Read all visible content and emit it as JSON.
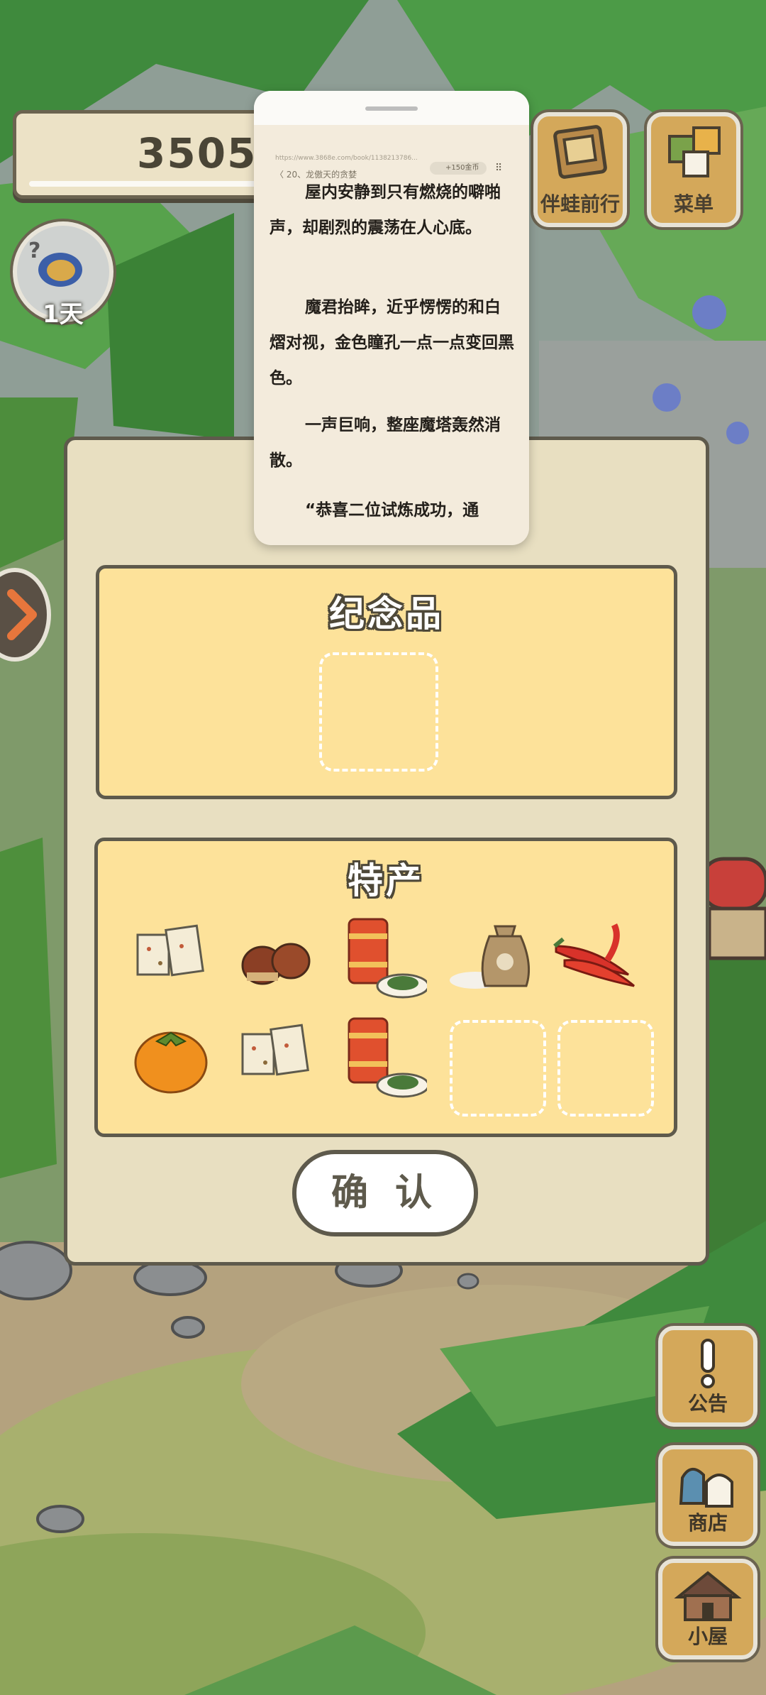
{
  "game": {
    "coins": "3505",
    "day_label": "1天",
    "top_buttons": {
      "travel_label": "伴蛙前行",
      "menu_label": "菜单"
    },
    "side_buttons": {
      "notice_label": "公告",
      "shop_label": "商店",
      "house_label": "小屋"
    }
  },
  "dialog": {
    "souvenir_title": "纪念品",
    "specialty_title": "特产",
    "specialty_items": [
      {
        "icon": "tofu-block-icon"
      },
      {
        "icon": "chestnut-icon"
      },
      {
        "icon": "tea-can-icon"
      },
      {
        "icon": "rice-bag-icon"
      },
      {
        "icon": "chili-pepper-icon"
      },
      {
        "icon": "persimmon-icon"
      },
      {
        "icon": "tofu-block-icon"
      },
      {
        "icon": "tea-can-icon"
      }
    ],
    "confirm_label": "确 认"
  },
  "reader": {
    "url": "https://www.3868e.com/book/1138213786...",
    "chapter": "〈 20、龙傲天的贪婪",
    "gold_badge": "+150金币",
    "more_icon": "grid-icon",
    "paragraphs": [
      "屋内安静到只有燃烧的噼啪声，却剧烈的震荡在人心底。",
      "魔君抬眸，近乎愣愣的和白熠对视，金色瞳孔一点一点变回黑色。",
      "一声巨响，整座魔塔轰然消散。",
      "“恭喜二位试炼成功，通"
    ]
  },
  "colors": {
    "panel_fill": "#fde29a",
    "dialog_fill": "#e8dfc1",
    "outline": "#5e5a4c",
    "button_wood": "#d4a85a"
  }
}
